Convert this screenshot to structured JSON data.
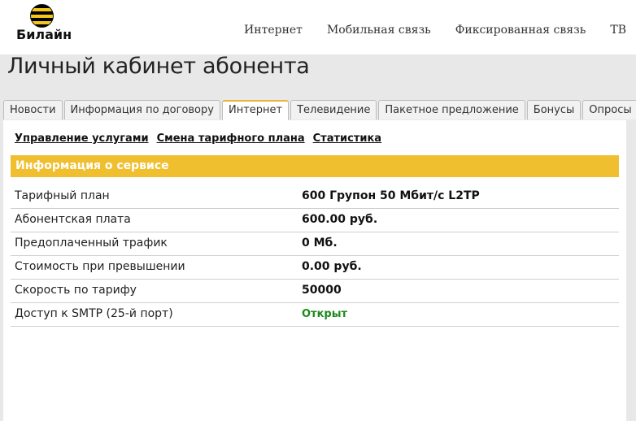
{
  "header": {
    "logo_text": "Билайн",
    "nav": [
      "Интернет",
      "Мобильная связь",
      "Фиксированная связь",
      "ТВ"
    ]
  },
  "page_title": "Личный кабинет абонента",
  "tabs": [
    "Новости",
    "Информация по договору",
    "Интернет",
    "Телевидение",
    "Пакетное предложение",
    "Бонусы",
    "Опросы"
  ],
  "active_tab": "Интернет",
  "subnav": [
    "Управление услугами",
    "Смена тарифного плана",
    "Статистика"
  ],
  "section_title": "Информация о сервисе",
  "rows": [
    {
      "label": "Тарифный план",
      "value": "600 Групон 50 Мбит/с L2TP"
    },
    {
      "label": "Абонентская плата",
      "value": "600.00 руб."
    },
    {
      "label": "Предоплаченный трафик",
      "value": "0 Мб."
    },
    {
      "label": "Стоимость при превышении",
      "value": "0.00 руб."
    },
    {
      "label": "Скорость по тарифу",
      "value": "50000"
    },
    {
      "label": "Доступ к SMTP (25-й порт)",
      "value": "Открыт"
    }
  ],
  "colors": {
    "accent": "#f0bf30",
    "status_open": "#1a8a1a"
  }
}
